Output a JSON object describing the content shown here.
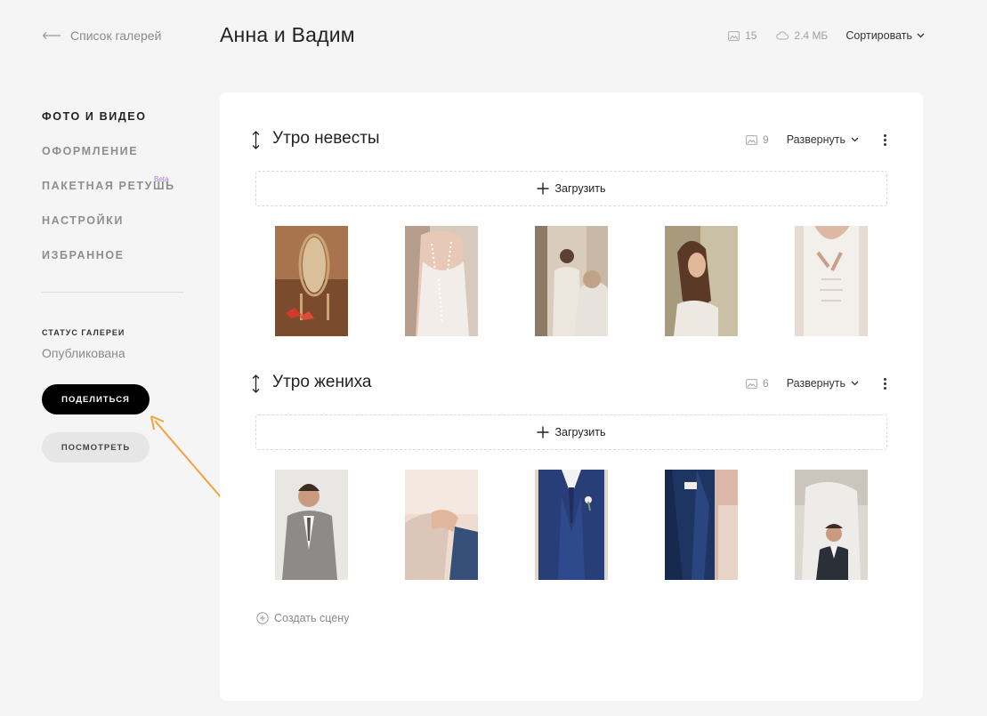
{
  "header": {
    "back_label": "Список галерей",
    "title": "Анна и Вадим",
    "photo_count": "15",
    "storage": "2.4 МБ",
    "sort_label": "Сортировать"
  },
  "sidebar": {
    "items": [
      {
        "label": "Фото и видео",
        "active": true
      },
      {
        "label": "Оформление"
      },
      {
        "label": "Пакетная ретушь",
        "badge": "Beta"
      },
      {
        "label": "Настройки"
      },
      {
        "label": "Избранное"
      }
    ],
    "status_label": "Статус галереи",
    "status_value": "Опубликована",
    "share_label": "Поделиться",
    "view_label": "Посмотреть"
  },
  "scenes": [
    {
      "title": "Утро невесты",
      "count": "9",
      "expand_label": "Развернуть",
      "upload_label": "Загрузить",
      "photos": [
        {
          "alt": "bride-shoes-mirror"
        },
        {
          "alt": "bride-dress-back"
        },
        {
          "alt": "bride-mirror-reflection"
        },
        {
          "alt": "bride-portrait"
        },
        {
          "alt": "bride-dress-lacing"
        }
      ]
    },
    {
      "title": "Утро жениха",
      "count": "6",
      "expand_label": "Развернуть",
      "upload_label": "Загрузить",
      "photos": [
        {
          "alt": "groom-vest-portrait"
        },
        {
          "alt": "cufflinks-hands"
        },
        {
          "alt": "groom-suit-boutonniere"
        },
        {
          "alt": "groom-suit-cuffs"
        },
        {
          "alt": "groom-mirror-reflection"
        }
      ]
    }
  ],
  "create_scene_label": "Создать сцену",
  "colors": {
    "accent_arrow": "#f2a33a",
    "beta_badge": "#b07ad8",
    "share_button": "#000000"
  }
}
